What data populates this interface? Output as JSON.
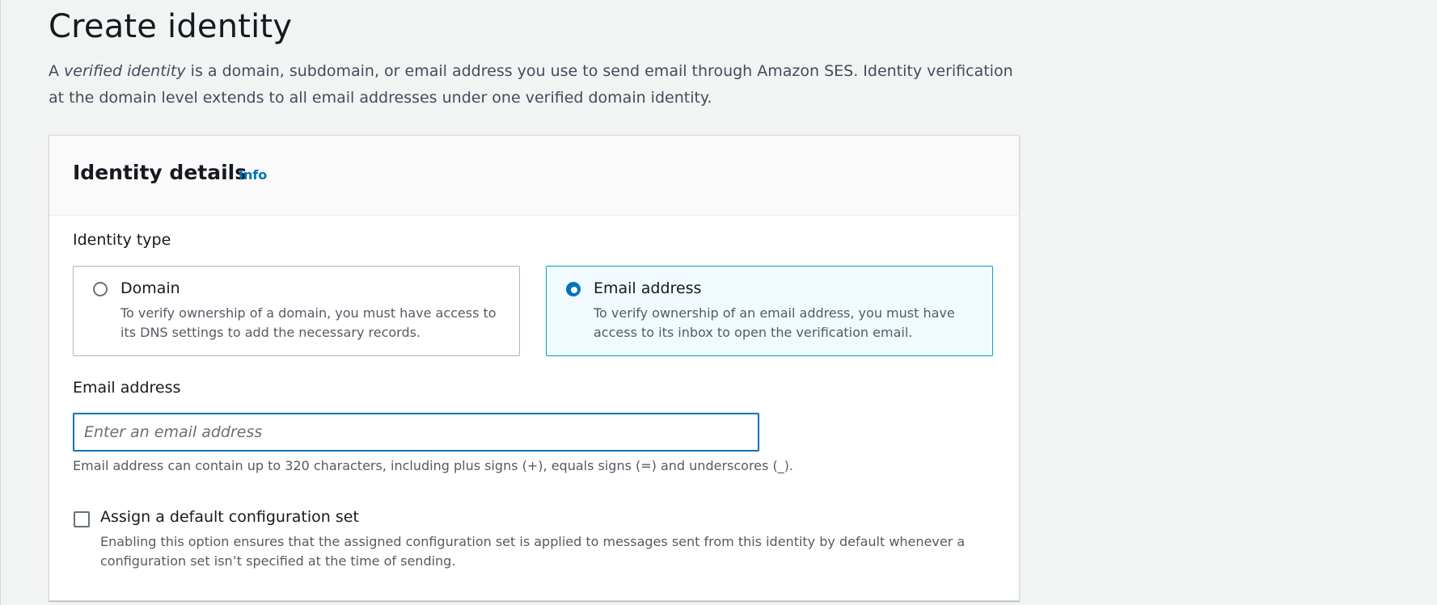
{
  "page": {
    "title": "Create identity",
    "intro_prefix": "A ",
    "intro_emphasis": "verified identity",
    "intro_suffix": " is a domain, subdomain, or email address you use to send email through Amazon SES. Identity verification at the domain level extends to all email addresses under one verified domain identity."
  },
  "panel": {
    "title": "Identity details",
    "info_link": "Info",
    "identity_type": {
      "label": "Identity type",
      "options": [
        {
          "label": "Domain",
          "description": "To verify ownership of a domain, you must have access to its DNS settings to add the necessary records.",
          "selected": false
        },
        {
          "label": "Email address",
          "description": "To verify ownership of an email address, you must have access to its inbox to open the verification email.",
          "selected": true
        }
      ]
    },
    "email": {
      "label": "Email address",
      "value": "",
      "placeholder": "Enter an email address",
      "hint": "Email address can contain up to 320 characters, including plus signs (+), equals signs (=) and underscores (_)."
    },
    "config_set": {
      "label": "Assign a default configuration set",
      "description": "Enabling this option ensures that the assigned configuration set is applied to messages sent from this identity by default whenever a configuration set isn’t specified at the time of sending.",
      "checked": false
    }
  },
  "colors": {
    "accent": "#0073bb",
    "selected_tile_border": "#00a1c9",
    "selected_tile_bg": "#f1faff",
    "page_bg": "#f2f3f3"
  }
}
